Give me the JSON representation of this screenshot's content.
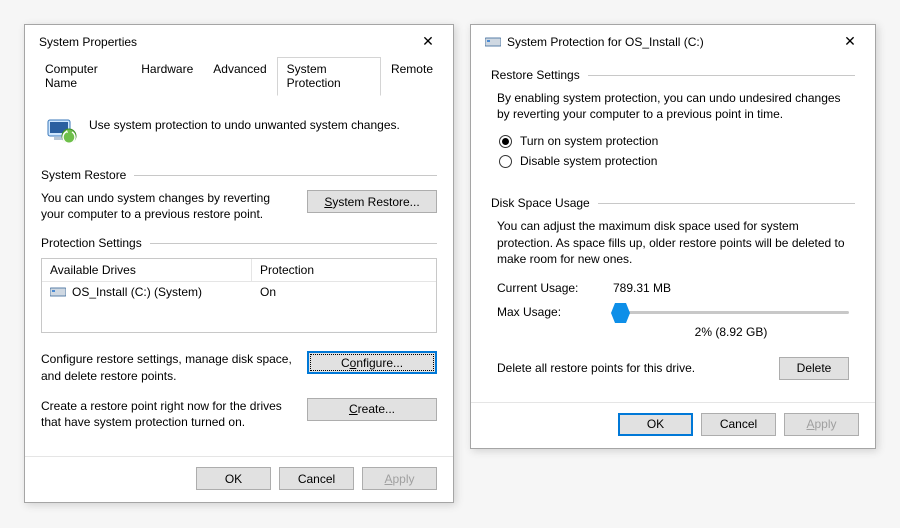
{
  "left": {
    "title": "System Properties",
    "tabs": [
      "Computer Name",
      "Hardware",
      "Advanced",
      "System Protection",
      "Remote"
    ],
    "active_tab": 3,
    "intro": "Use system protection to undo unwanted system changes.",
    "restore_group": "System Restore",
    "restore_text": "You can undo system changes by reverting your computer to a previous restore point.",
    "restore_btn": "System Restore...",
    "settings_group": "Protection Settings",
    "col_drives": "Available Drives",
    "col_prot": "Protection",
    "drive_name": "OS_Install (C:) (System)",
    "drive_prot": "On",
    "configure_text": "Configure restore settings, manage disk space, and delete restore points.",
    "configure_btn": "Configure...",
    "create_text": "Create a restore point right now for the drives that have system protection turned on.",
    "create_btn": "Create...",
    "ok": "OK",
    "cancel": "Cancel",
    "apply": "Apply"
  },
  "right": {
    "title": "System Protection for OS_Install (C:)",
    "restore_group": "Restore Settings",
    "restore_text": "By enabling system protection, you can undo undesired changes by reverting your computer to a previous point in time.",
    "radio_on": "Turn on system protection",
    "radio_off": "Disable system protection",
    "radio_selected": "on",
    "usage_group": "Disk Space Usage",
    "usage_text": "You can adjust the maximum disk space used for system protection. As space fills up, older restore points will be deleted to make room for new ones.",
    "current_label": "Current Usage:",
    "current_value": "789.31 MB",
    "max_label": "Max Usage:",
    "max_value": "2% (8.92 GB)",
    "slider_percent": 2,
    "delete_text": "Delete all restore points for this drive.",
    "delete_btn": "Delete",
    "ok": "OK",
    "cancel": "Cancel",
    "apply": "Apply"
  }
}
